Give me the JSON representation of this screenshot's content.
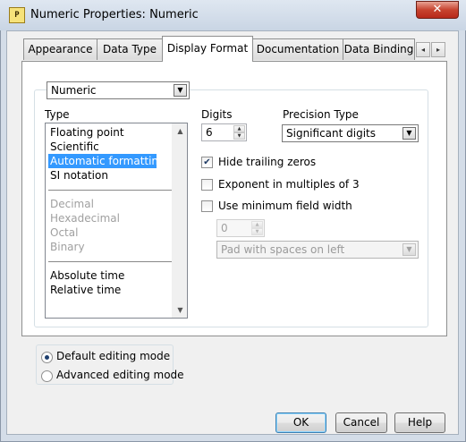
{
  "window": {
    "icon": "app-icon",
    "icon_text": "P",
    "title": "Numeric Properties: Numeric",
    "close_glyph": "✕"
  },
  "tabs": [
    {
      "label": "Appearance",
      "active": false
    },
    {
      "label": "Data Type",
      "active": false
    },
    {
      "label": "Display Format",
      "active": true
    },
    {
      "label": "Documentation",
      "active": false
    },
    {
      "label": "Data Binding",
      "active": false
    }
  ],
  "tab_scroll": {
    "left_glyph": "◂",
    "right_glyph": "▸"
  },
  "format": {
    "selector_value": "Numeric",
    "type_label": "Type",
    "type_list": [
      {
        "label": "Floating point",
        "state": "normal"
      },
      {
        "label": "Scientific",
        "state": "normal"
      },
      {
        "label": "Automatic formatting",
        "state": "selected"
      },
      {
        "label": "SI notation",
        "state": "normal"
      },
      {
        "label": "Decimal",
        "state": "disabled"
      },
      {
        "label": "Hexadecimal",
        "state": "disabled"
      },
      {
        "label": "Octal",
        "state": "disabled"
      },
      {
        "label": "Binary",
        "state": "disabled"
      },
      {
        "label": "Absolute time",
        "state": "normal"
      },
      {
        "label": "Relative time",
        "state": "normal"
      }
    ],
    "digits_label": "Digits",
    "digits_value": "6",
    "precision_label": "Precision Type",
    "precision_value": "Significant digits",
    "hide_trailing_zeros": {
      "label": "Hide trailing zeros",
      "checked": true
    },
    "exponent_multiples_3": {
      "label": "Exponent in multiples of 3",
      "checked": false
    },
    "min_field_width": {
      "label": "Use minimum field width",
      "checked": false
    },
    "field_width_value": "0",
    "pad_value": "Pad with spaces on left"
  },
  "editing_mode": {
    "default_label": "Default editing mode",
    "advanced_label": "Advanced editing mode",
    "selected": "default"
  },
  "buttons": {
    "ok": "OK",
    "cancel": "Cancel",
    "help": "Help"
  },
  "glyphs": {
    "check": "✔",
    "combo_arrow": "▼",
    "up": "▲",
    "down": "▼"
  }
}
